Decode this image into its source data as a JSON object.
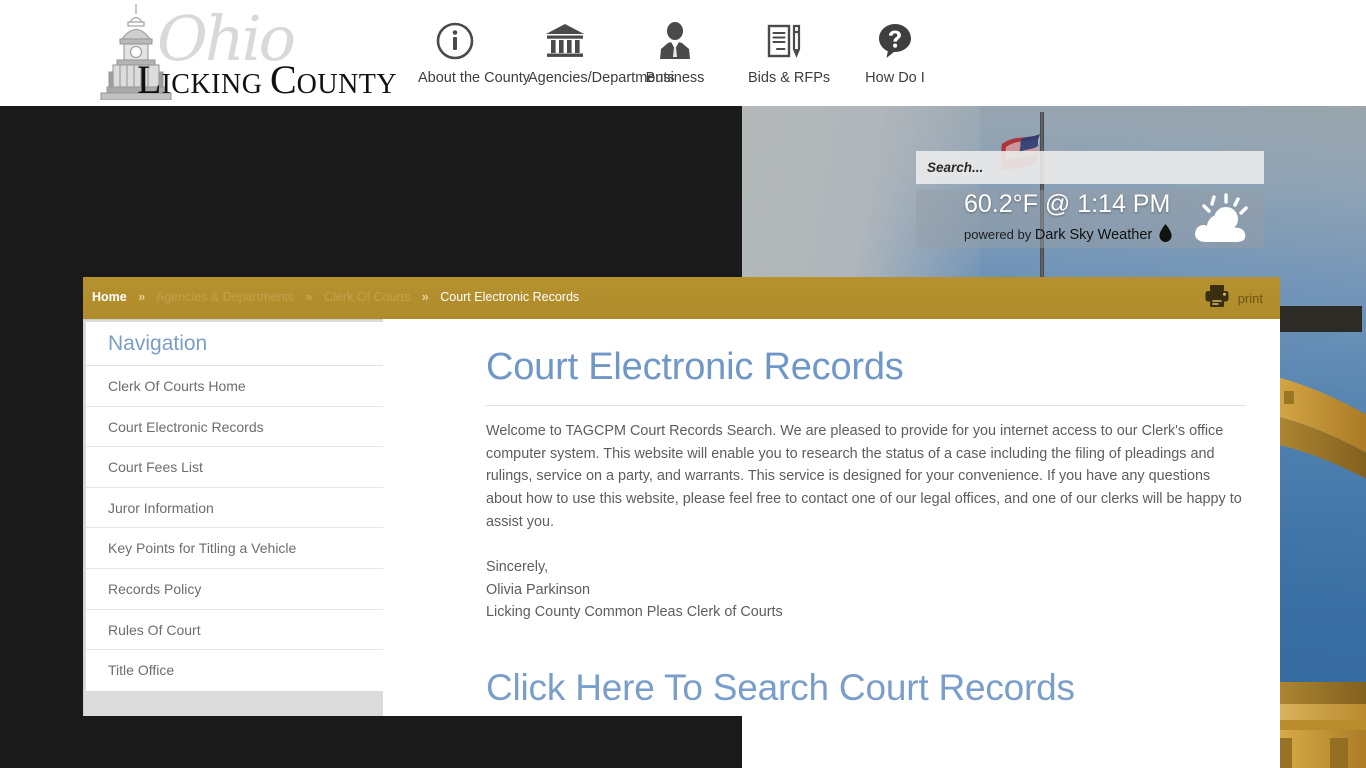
{
  "header": {
    "logo": {
      "script_word": "Ohio",
      "county_name_prefix": "L",
      "county_name_rest": "ICKING ",
      "county_word_cap": "C",
      "county_word_rest": "OUNTY",
      "icon": "courthouse-logo-icon"
    },
    "nav": [
      {
        "label": "About the County",
        "icon": "info-circle-icon"
      },
      {
        "label": "Agencies/Departments",
        "icon": "bank-building-icon"
      },
      {
        "label": "Business",
        "icon": "businessperson-icon"
      },
      {
        "label": "Bids & RFPs",
        "icon": "document-pen-icon"
      },
      {
        "label": "How Do I",
        "icon": "question-speech-bubble-icon"
      }
    ]
  },
  "search": {
    "placeholder": "Search...",
    "value": ""
  },
  "weather": {
    "temperature": "60.2°F @ 1:14 PM",
    "credit_prefix": "powered by ",
    "credit_brand": "Dark Sky Weather",
    "drop_icon": "water-drop-icon",
    "condition_icon": "partly-cloudy-icon"
  },
  "breadcrumb": {
    "items": [
      {
        "label": "Home",
        "style": "strong"
      },
      {
        "label": "Agencies & Departments",
        "style": "dim"
      },
      {
        "label": "Clerk Of Courts",
        "style": "dim"
      },
      {
        "label": "Court Electronic Records",
        "style": "last"
      }
    ],
    "separator": "»"
  },
  "print": {
    "label": "print",
    "icon": "printer-icon"
  },
  "sidebar": {
    "title": "Navigation",
    "items": [
      {
        "label": "Clerk Of Courts Home"
      },
      {
        "label": "Court Electronic Records"
      },
      {
        "label": "Court Fees List"
      },
      {
        "label": "Juror Information"
      },
      {
        "label": "Key Points for Titling a Vehicle"
      },
      {
        "label": "Records Policy"
      },
      {
        "label": "Rules Of Court"
      },
      {
        "label": "Title Office"
      }
    ]
  },
  "main": {
    "title": "Court Electronic Records",
    "intro": "Welcome to TAGCPM Court Records Search. We are pleased to provide for you internet access to our Clerk's office computer system. This website will enable you to research the status of a case including the filing of pleadings and rulings, service on a party, and warrants. This service is designed for your convenience. If you have any questions about how to use this website, please feel free to contact one of our legal offices, and one of our clerks will be happy to assist you.",
    "signoff": "Sincerely,",
    "signer_name": "Olivia Parkinson",
    "signer_title": "Licking County Common Pleas Clerk of Courts",
    "cta_link": "Click Here To Search Court Records"
  },
  "colors": {
    "breadcrumb_gold": "#b5912f",
    "title_blue": "#6f97c8",
    "link_blue": "#7a9ecb",
    "nav_title_blue": "#7b9ec9",
    "body_gray": "#5d5d5d",
    "page_dark": "#1a1a1a"
  }
}
